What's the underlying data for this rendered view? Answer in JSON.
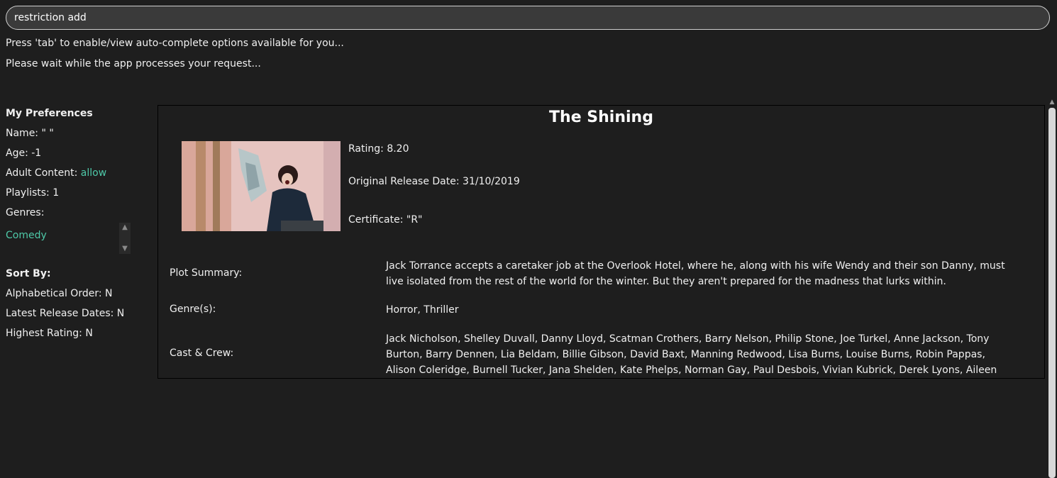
{
  "command": {
    "value": "restriction add"
  },
  "hints": {
    "autocomplete": "Press 'tab' to enable/view auto-complete options available for you...",
    "wait": "Please wait while the app processes your request..."
  },
  "preferences": {
    "heading": "My Preferences",
    "name_label": "Name:",
    "name_value": "\" \"",
    "age_label": "Age:",
    "age_value": "-1",
    "adult_label": "Adult Content:",
    "adult_value": "allow",
    "playlists_label": "Playlists:",
    "playlists_value": "1",
    "genres_label": "Genres:",
    "genres": [
      "Comedy"
    ]
  },
  "sort": {
    "heading": "Sort By:",
    "alphabetical_label": "Alphabetical Order:",
    "alphabetical_value": "N",
    "latest_label": "Latest Release Dates:",
    "latest_value": "N",
    "rating_label": "Highest Rating:",
    "rating_value": "N"
  },
  "movie": {
    "title": "The Shining",
    "rating_label": "Rating:",
    "rating_value": "8.20",
    "release_label": "Original Release Date:",
    "release_value": "31/10/2019",
    "certificate_label": "Certificate:",
    "certificate_value": "\"R\"",
    "plot_label": "Plot Summary:",
    "plot_value": "Jack Torrance accepts a caretaker job at the Overlook Hotel, where he, along with his wife Wendy and their son Danny, must live isolated from the rest of the world for the winter. But they aren't prepared for the madness that lurks within.",
    "genres_label": "Genre(s):",
    "genres_value": "Horror, Thriller",
    "cast_label": "Cast & Crew:",
    "cast_value": "Jack Nicholson, Shelley Duvall, Danny Lloyd, Scatman Crothers, Barry Nelson, Philip Stone, Joe Turkel, Anne Jackson, Tony Burton, Barry Dennen, Lia Beldam, Billie Gibson, David Baxt, Manning Redwood, Lisa Burns, Louise Burns, Robin Pappas, Alison Coleridge, Burnell Tucker, Jana Shelden, Kate Phelps, Norman Gay, Paul Desbois, Vivian Kubrick, Derek Lyons, Aileen Lewis, Chris Parsons,"
  },
  "colors": {
    "background": "#1e1e1e",
    "accent": "#4ec9a8",
    "input_background": "#3a3a3a"
  }
}
